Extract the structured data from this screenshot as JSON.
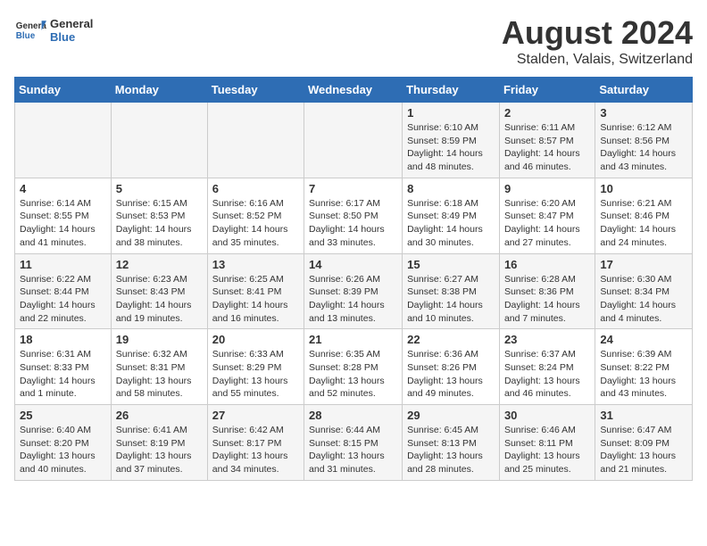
{
  "header": {
    "logo_general": "General",
    "logo_blue": "Blue",
    "month_year": "August 2024",
    "location": "Stalden, Valais, Switzerland"
  },
  "days_of_week": [
    "Sunday",
    "Monday",
    "Tuesday",
    "Wednesday",
    "Thursday",
    "Friday",
    "Saturday"
  ],
  "weeks": [
    [
      {
        "day": "",
        "info": ""
      },
      {
        "day": "",
        "info": ""
      },
      {
        "day": "",
        "info": ""
      },
      {
        "day": "",
        "info": ""
      },
      {
        "day": "1",
        "info": "Sunrise: 6:10 AM\nSunset: 8:59 PM\nDaylight: 14 hours and 48 minutes."
      },
      {
        "day": "2",
        "info": "Sunrise: 6:11 AM\nSunset: 8:57 PM\nDaylight: 14 hours and 46 minutes."
      },
      {
        "day": "3",
        "info": "Sunrise: 6:12 AM\nSunset: 8:56 PM\nDaylight: 14 hours and 43 minutes."
      }
    ],
    [
      {
        "day": "4",
        "info": "Sunrise: 6:14 AM\nSunset: 8:55 PM\nDaylight: 14 hours and 41 minutes."
      },
      {
        "day": "5",
        "info": "Sunrise: 6:15 AM\nSunset: 8:53 PM\nDaylight: 14 hours and 38 minutes."
      },
      {
        "day": "6",
        "info": "Sunrise: 6:16 AM\nSunset: 8:52 PM\nDaylight: 14 hours and 35 minutes."
      },
      {
        "day": "7",
        "info": "Sunrise: 6:17 AM\nSunset: 8:50 PM\nDaylight: 14 hours and 33 minutes."
      },
      {
        "day": "8",
        "info": "Sunrise: 6:18 AM\nSunset: 8:49 PM\nDaylight: 14 hours and 30 minutes."
      },
      {
        "day": "9",
        "info": "Sunrise: 6:20 AM\nSunset: 8:47 PM\nDaylight: 14 hours and 27 minutes."
      },
      {
        "day": "10",
        "info": "Sunrise: 6:21 AM\nSunset: 8:46 PM\nDaylight: 14 hours and 24 minutes."
      }
    ],
    [
      {
        "day": "11",
        "info": "Sunrise: 6:22 AM\nSunset: 8:44 PM\nDaylight: 14 hours and 22 minutes."
      },
      {
        "day": "12",
        "info": "Sunrise: 6:23 AM\nSunset: 8:43 PM\nDaylight: 14 hours and 19 minutes."
      },
      {
        "day": "13",
        "info": "Sunrise: 6:25 AM\nSunset: 8:41 PM\nDaylight: 14 hours and 16 minutes."
      },
      {
        "day": "14",
        "info": "Sunrise: 6:26 AM\nSunset: 8:39 PM\nDaylight: 14 hours and 13 minutes."
      },
      {
        "day": "15",
        "info": "Sunrise: 6:27 AM\nSunset: 8:38 PM\nDaylight: 14 hours and 10 minutes."
      },
      {
        "day": "16",
        "info": "Sunrise: 6:28 AM\nSunset: 8:36 PM\nDaylight: 14 hours and 7 minutes."
      },
      {
        "day": "17",
        "info": "Sunrise: 6:30 AM\nSunset: 8:34 PM\nDaylight: 14 hours and 4 minutes."
      }
    ],
    [
      {
        "day": "18",
        "info": "Sunrise: 6:31 AM\nSunset: 8:33 PM\nDaylight: 14 hours and 1 minute."
      },
      {
        "day": "19",
        "info": "Sunrise: 6:32 AM\nSunset: 8:31 PM\nDaylight: 13 hours and 58 minutes."
      },
      {
        "day": "20",
        "info": "Sunrise: 6:33 AM\nSunset: 8:29 PM\nDaylight: 13 hours and 55 minutes."
      },
      {
        "day": "21",
        "info": "Sunrise: 6:35 AM\nSunset: 8:28 PM\nDaylight: 13 hours and 52 minutes."
      },
      {
        "day": "22",
        "info": "Sunrise: 6:36 AM\nSunset: 8:26 PM\nDaylight: 13 hours and 49 minutes."
      },
      {
        "day": "23",
        "info": "Sunrise: 6:37 AM\nSunset: 8:24 PM\nDaylight: 13 hours and 46 minutes."
      },
      {
        "day": "24",
        "info": "Sunrise: 6:39 AM\nSunset: 8:22 PM\nDaylight: 13 hours and 43 minutes."
      }
    ],
    [
      {
        "day": "25",
        "info": "Sunrise: 6:40 AM\nSunset: 8:20 PM\nDaylight: 13 hours and 40 minutes."
      },
      {
        "day": "26",
        "info": "Sunrise: 6:41 AM\nSunset: 8:19 PM\nDaylight: 13 hours and 37 minutes."
      },
      {
        "day": "27",
        "info": "Sunrise: 6:42 AM\nSunset: 8:17 PM\nDaylight: 13 hours and 34 minutes."
      },
      {
        "day": "28",
        "info": "Sunrise: 6:44 AM\nSunset: 8:15 PM\nDaylight: 13 hours and 31 minutes."
      },
      {
        "day": "29",
        "info": "Sunrise: 6:45 AM\nSunset: 8:13 PM\nDaylight: 13 hours and 28 minutes."
      },
      {
        "day": "30",
        "info": "Sunrise: 6:46 AM\nSunset: 8:11 PM\nDaylight: 13 hours and 25 minutes."
      },
      {
        "day": "31",
        "info": "Sunrise: 6:47 AM\nSunset: 8:09 PM\nDaylight: 13 hours and 21 minutes."
      }
    ]
  ]
}
